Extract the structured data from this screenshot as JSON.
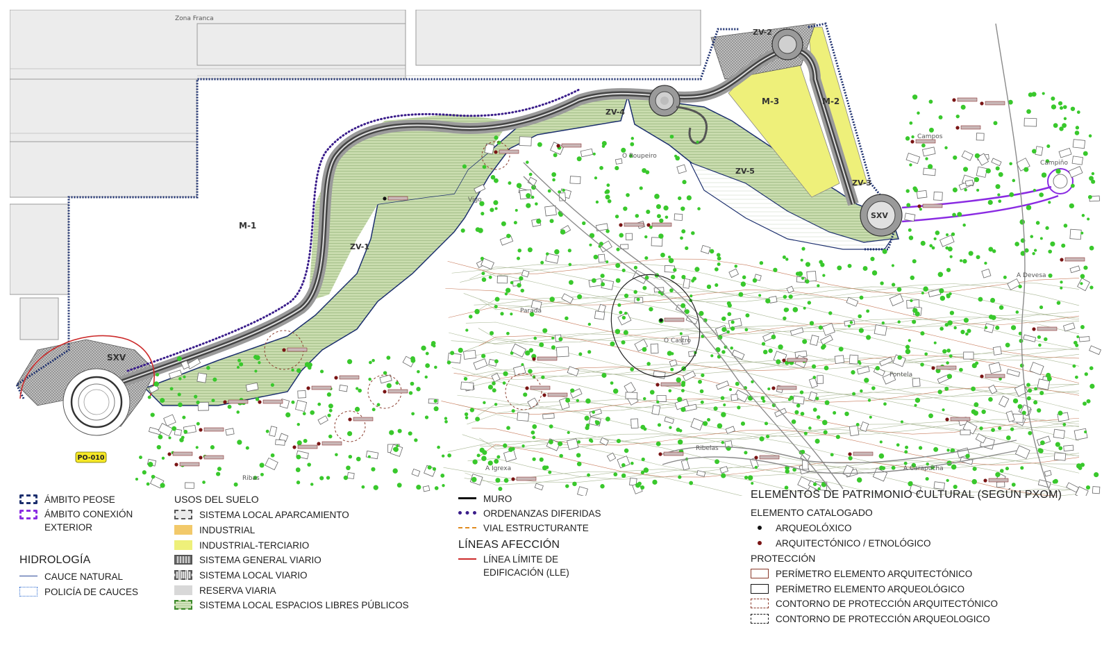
{
  "map": {
    "zones": {
      "m1": "M-1",
      "m2": "M-2",
      "m3": "M-3",
      "zv1": "ZV-1",
      "zv2": "ZV-2",
      "zv3": "ZV-3",
      "zv4": "ZV-4",
      "zv5": "ZV-5",
      "sxv_west": "SXV",
      "sxv_east": "SXV",
      "road_badge": "PO-010"
    },
    "places": {
      "zona_franca": "Zona Franca",
      "vigo": "Vigo",
      "o_roupeiro": "O Roupeiro",
      "campos": "Campos",
      "campino": "Campiño",
      "parada": "Parada",
      "o_castro": "O Castro",
      "a_devesa": "A Devesa",
      "fontela": "Fontela",
      "ribelas": "Ribelas",
      "a_igrexa": "A Igrexa",
      "a_carapucha": "A Carapucha",
      "ribas": "Ribas"
    },
    "colors": {
      "green_zone": "#c9dcae",
      "yellow_zone": "#eef07a",
      "peose_boundary": "#1c2f6e",
      "exterior_boundary": "#8a2be2",
      "road_grey": "#9a9a9a",
      "tree_green": "#39c82c",
      "lle_red": "#cc2b2b",
      "heritage_dot": "#7a1414"
    }
  },
  "legend": {
    "col1": {
      "ambito_peose": "ÁMBITO PEOSE",
      "ambito_conexion_1": "ÁMBITO CONEXIÓN",
      "ambito_conexion_2": "EXTERIOR",
      "hidrologia_title": "HIDROLOGÍA",
      "cauce_natural": "CAUCE NATURAL",
      "policia_cauces": "POLICÍA DE CAUCES"
    },
    "col2": {
      "title": "USOS DEL SUELO",
      "items": [
        "SISTEMA LOCAL APARCAMIENTO",
        "INDUSTRIAL",
        "INDUSTRIAL-TERCIARIO",
        "SISTEMA GENERAL VIARIO",
        "SISTEMA LOCAL VIARIO",
        "RESERVA VIARIA",
        "SISTEMA LOCAL ESPACIOS LIBRES PÚBLICOS"
      ]
    },
    "col3": {
      "muro": "MURO",
      "ordenanzas": "ORDENANZAS DIFERIDAS",
      "vial": "VIAL ESTRUCTURANTE",
      "lineas_title": "LÍNEAS AFECCIÓN",
      "lle_1": "LÍNEA LÍMITE DE",
      "lle_2": "EDIFICACIÓN (LLE)"
    },
    "col4": {
      "title": "ELEMENTOS DE PATRIMONIO CULTURAL (SEGÚN PXOM)",
      "catalogado": "ELEMENTO CATALOGADO",
      "arqueoloxico": "ARQUEOLÓXICO",
      "arquitectonico": "ARQUITECTÓNICO / ETNOLÓGICO",
      "proteccion": "PROTECCIÓN",
      "items": [
        "PERÍMETRO ELEMENTO ARQUITECTÓNICO",
        "PERÍMETRO ELEMENTO ARQUEOLÓGICO",
        "CONTORNO DE PROTECCIÓN ARQUITECTÓNICO",
        "CONTORNO DE PROTECCIÓN ARQUEOLOGICO"
      ]
    }
  }
}
